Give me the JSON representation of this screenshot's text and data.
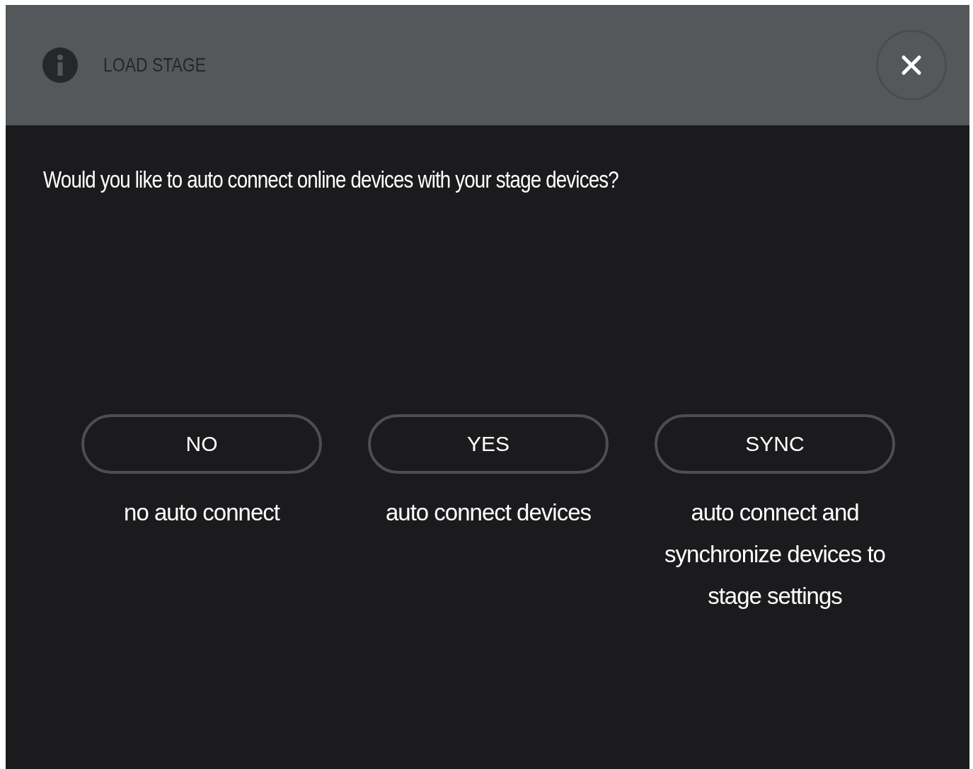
{
  "dialog": {
    "title": "LOAD STAGE",
    "question": "Would you like to auto connect online devices with your stage devices?",
    "options": [
      {
        "label": "NO",
        "description": "no auto connect"
      },
      {
        "label": "YES",
        "description": "auto connect devices"
      },
      {
        "label": "SYNC",
        "description": "auto connect and synchronize devices to stage settings"
      }
    ]
  }
}
